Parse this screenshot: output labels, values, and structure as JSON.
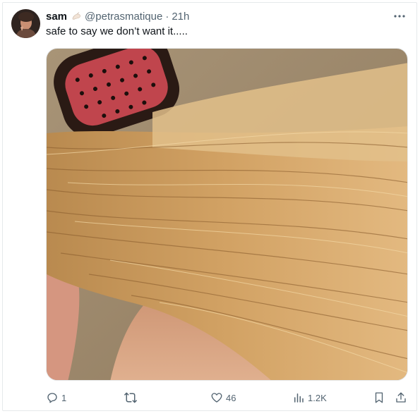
{
  "tweet": {
    "author": {
      "display_name": "sam",
      "verified_badge_icon": "hand-emoji-icon",
      "handle": "@petrasmatique",
      "separator": "·",
      "time": "21h"
    },
    "text": "safe to say we don’t want it.....",
    "media": {
      "description_icon": "hair-brush-photo"
    },
    "actions": {
      "reply_count": "1",
      "retweet_count": "",
      "like_count": "46",
      "view_count": "1.2K"
    }
  },
  "colors": {
    "text_primary": "#0f1419",
    "text_secondary": "#536471",
    "border": "#e6e9eb"
  }
}
